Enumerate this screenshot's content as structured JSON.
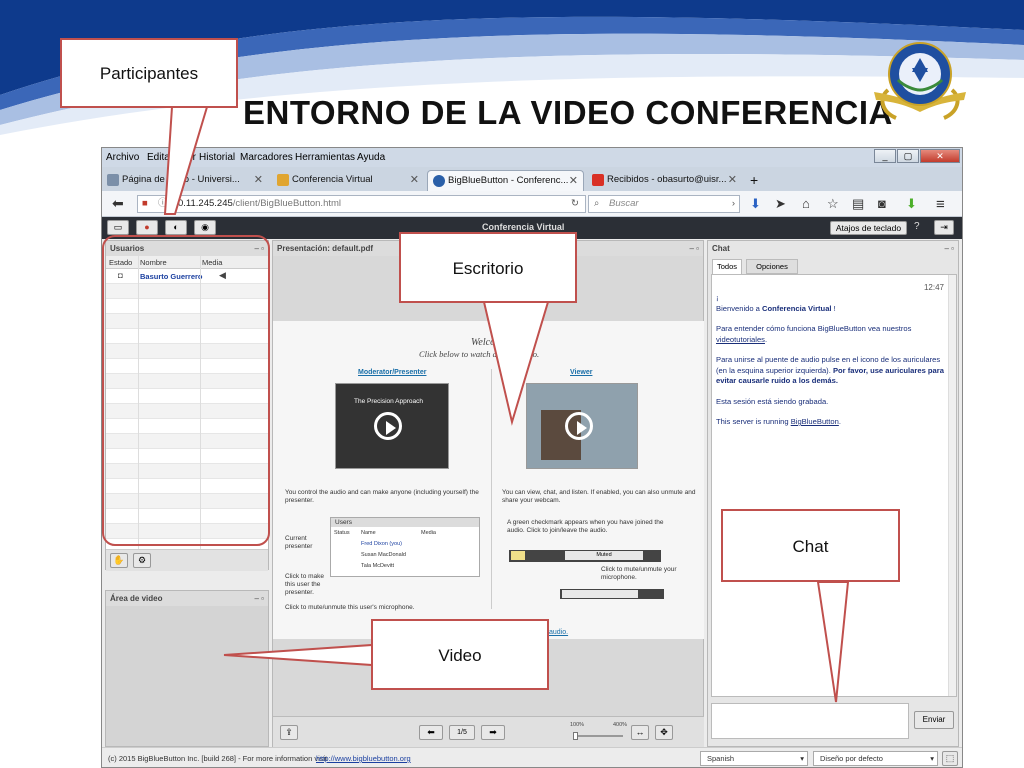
{
  "slide": {
    "title": "ENTORNO DE LA VIDEO CONFERENCIA",
    "logo_icon": "university-seal-logo",
    "logo_text": "UNIVERSIDAD ISRAEL",
    "colors": {
      "band_blue": "#0e3a8c",
      "callout_red": "#c0504d"
    }
  },
  "callouts": [
    {
      "label": "Participantes"
    },
    {
      "label": "Escritorio"
    },
    {
      "label": "Chat"
    },
    {
      "label": "Video"
    }
  ],
  "browser": {
    "menu": [
      "Archivo",
      "Editar",
      "Ver",
      "Historial",
      "Marcadores",
      "Herramientas",
      "Ayuda"
    ],
    "tabs": [
      {
        "title": "Página de inicio - Universi...",
        "icon": "page-icon"
      },
      {
        "title": "Conferencia Virtual",
        "icon": "folder-icon"
      },
      {
        "title": "BigBlueButton - Conferenc...",
        "icon": "bbb-icon"
      },
      {
        "title": "Recibidos - obasurto@uisr...",
        "icon": "gmail-icon"
      }
    ],
    "new_tab": "+",
    "url_host": "0.11.245.245",
    "url_path": "/client/BigBlueButton.html",
    "search_placeholder": "Buscar",
    "window_buttons": [
      "_",
      "▢",
      "✕"
    ]
  },
  "bbb": {
    "title": "Conferencia Virtual",
    "shortcuts": "Atajos de teclado",
    "help": "?",
    "users_panel": {
      "title": "Usuarios",
      "columns": [
        "Estado",
        "Nombre",
        "Media"
      ],
      "users": [
        {
          "name": "Basurto Guerrero"
        }
      ]
    },
    "video_panel": {
      "title": "Área de video"
    },
    "presentation": {
      "title": "Presentación: default.pdf",
      "welcome": "Welcome",
      "click_below": "Click below to watch a short video.",
      "moderator": "Moderator/Presenter",
      "viewer": "Viewer",
      "video_title": "The Precision Approach",
      "mod_desc": "You control the audio and can make anyone (including yourself) the presenter.",
      "viewer_desc": "You can view, chat, and listen. If enabled, you can also unmute and share your webcam.",
      "users_mini": [
        "Users",
        "Status",
        "Name",
        "Media",
        "Fred Dixon (you)",
        "Susan MacDonald",
        "Tala McDevitt"
      ],
      "current_presenter": "Current presenter",
      "click_make": "Click to make this user the presenter.",
      "click_mute_user": "Click to mute/unmute this user's microphone.",
      "green_check": "A green checkmark appears when you have joined the audio. Click to join/leave the audio.",
      "muted": "Muted",
      "click_mute_mic": "Click to mute/unmute your microphone.",
      "audio_link": "audio.",
      "page": "1/5",
      "zoom_min": "100%",
      "zoom_max": "400%"
    },
    "chat": {
      "title": "Chat",
      "tabs": [
        "Todos",
        "Opciones"
      ],
      "time": "12:47",
      "welcome_pre": "Bienvenido a ",
      "welcome_bold": "Conferencia Virtual",
      "welcome_post": "!",
      "p2_pre": "Para entender cómo funciona BigBlueButton vea nuestros ",
      "p2_link": "videotutoriales",
      "p2_post": ".",
      "p3_pre": "Para unirse al puente de audio pulse en el icono de los auriculares (en la esquina superior izquierda). ",
      "p3_bold": "Por favor, use auriculares para evitar causarle ruido a los demás.",
      "p4": "Esta sesión está siendo grabada.",
      "p5_pre": "This server is running ",
      "p5_link": "BigBlueButton",
      "p5_post": ".",
      "send": "Enviar"
    },
    "footer": {
      "copyright": "(c) 2015 BigBlueButton Inc. [build 268] - For more information visit",
      "link": "http://www.bigbluebutton.org",
      "language": "Spanish",
      "layout": "Diseño por defecto"
    }
  }
}
